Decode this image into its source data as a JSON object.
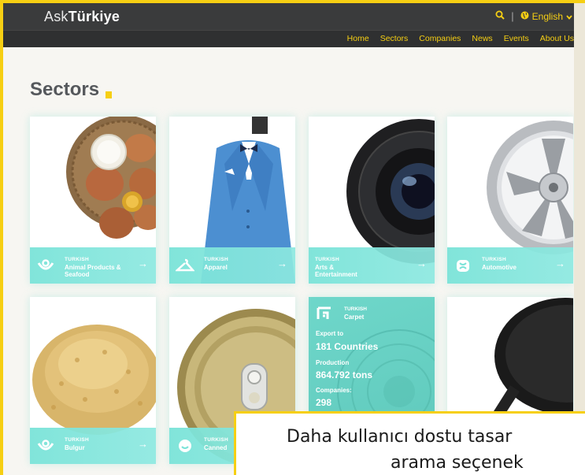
{
  "header": {
    "logo_light": "Ask",
    "logo_bold": "Türkiye",
    "language": "English",
    "nav": [
      "Home",
      "Sectors",
      "Companies",
      "News",
      "Events",
      "About Us"
    ]
  },
  "page": {
    "title": "Sectors"
  },
  "cards": [
    {
      "kicker": "TURKISH",
      "name": "Animal Products & Seafood",
      "icon": "fish-icon"
    },
    {
      "kicker": "TURKISH",
      "name": "Apparel",
      "icon": "hanger-icon"
    },
    {
      "kicker": "TURKISH",
      "name": "Arts & Entertainment",
      "icon": ""
    },
    {
      "kicker": "TURKISH",
      "name": "Automotive",
      "icon": "car-icon"
    },
    {
      "kicker": "TURKISH",
      "name": "Bulgur",
      "icon": "grain-icon"
    },
    {
      "kicker": "TURKISH",
      "name": "Canned",
      "icon": "can-icon"
    },
    {
      "kicker": "TURKISH",
      "name": "Carpet",
      "icon": "carpet-icon",
      "stats": {
        "export_label": "Export to",
        "export_value": "181 Countries",
        "production_label": "Production",
        "production_value": "864.792 tons",
        "companies_label": "Companies:",
        "companies_value": "298"
      }
    },
    {
      "kicker": "",
      "name": "",
      "icon": ""
    }
  ],
  "caption": {
    "line1": "Daha kullanıcı dostu tasar",
    "line2": "arama seçenek"
  },
  "colors": {
    "accent": "#f6cf13",
    "teal": "#7ae3d8",
    "header": "#3a3b3c"
  }
}
